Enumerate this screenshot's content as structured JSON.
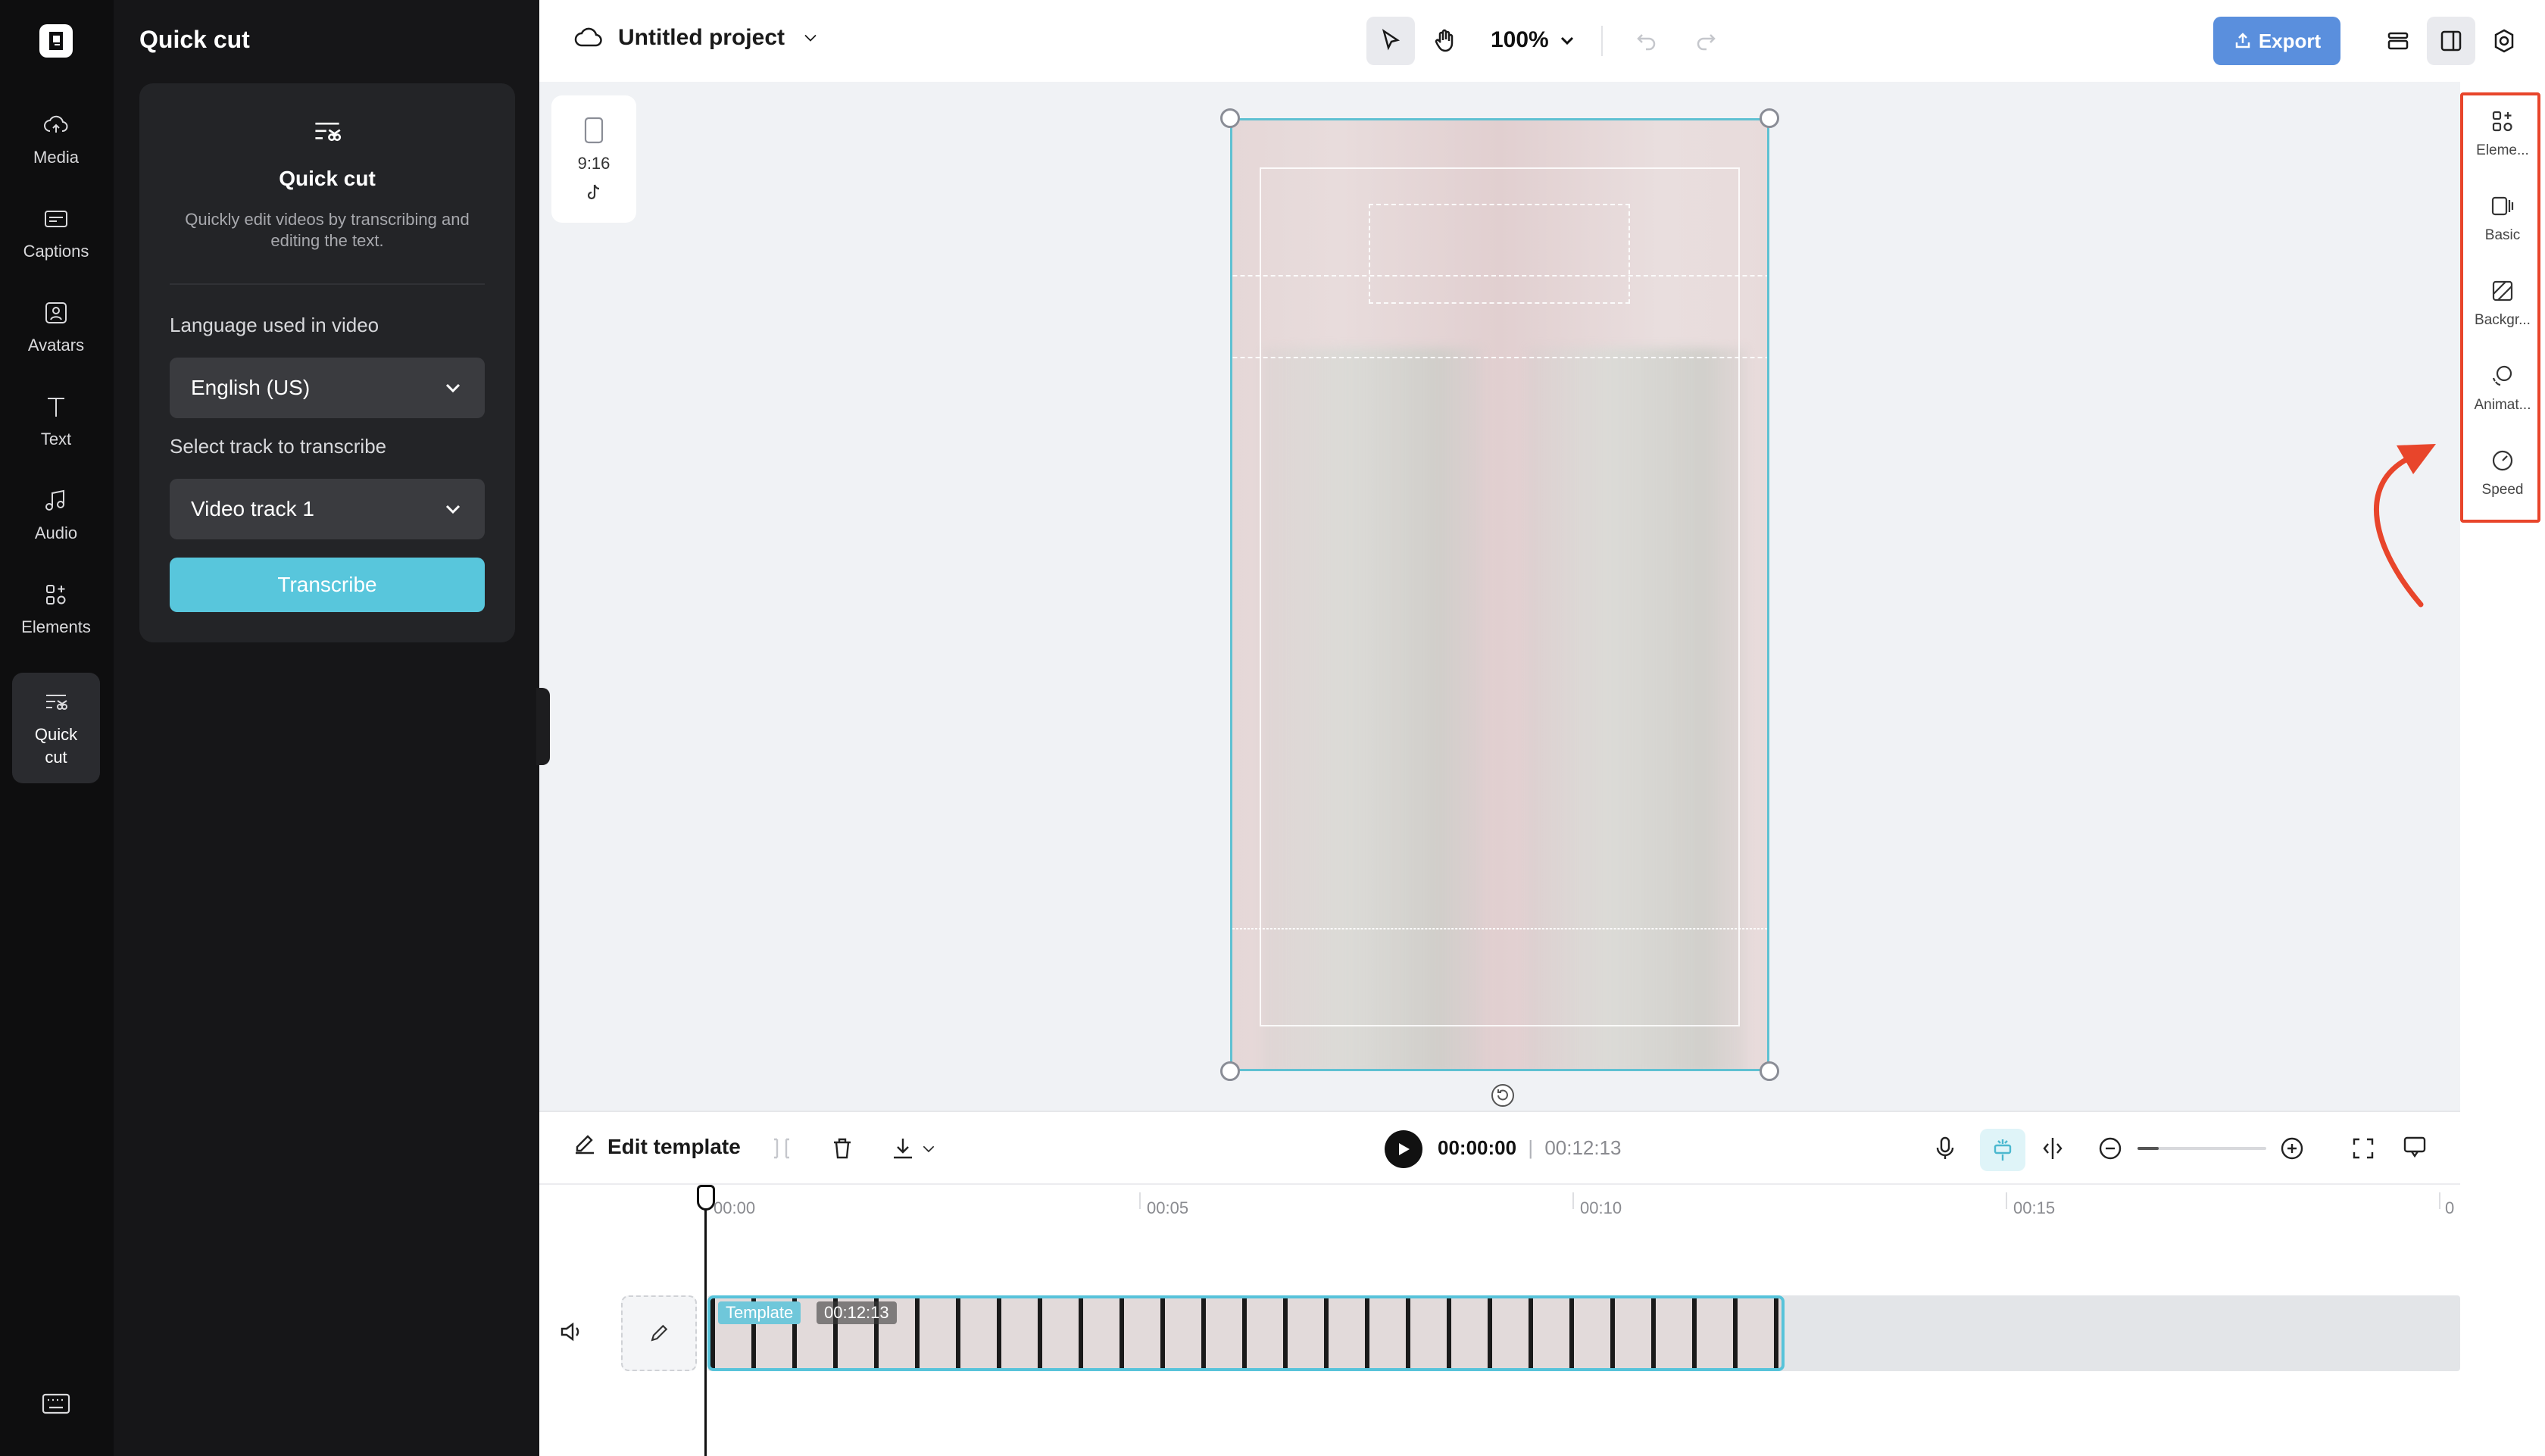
{
  "rail": {
    "items": [
      {
        "label": "Media",
        "icon": "cloud-upload-icon"
      },
      {
        "label": "Captions",
        "icon": "captions-icon"
      },
      {
        "label": "Avatars",
        "icon": "avatar-icon"
      },
      {
        "label": "Text",
        "icon": "text-icon"
      },
      {
        "label": "Audio",
        "icon": "music-note-icon"
      },
      {
        "label": "Elements",
        "icon": "elements-icon"
      },
      {
        "label": "Quick\ncut",
        "icon": "quick-cut-icon"
      }
    ],
    "active": "Quick cut"
  },
  "panel": {
    "title": "Quick cut",
    "card_title": "Quick cut",
    "card_desc": "Quickly edit videos by transcribing and editing the text.",
    "language_label": "Language used in video",
    "language_value": "English (US)",
    "track_label": "Select track to transcribe",
    "track_value": "Video track 1",
    "transcribe_label": "Transcribe"
  },
  "topbar": {
    "project_name": "Untitled project",
    "zoom": "100%",
    "export_label": "Export"
  },
  "ratio": {
    "label": "9:16"
  },
  "rightbar": {
    "items": [
      {
        "label": "Eleme...",
        "icon": "elements-icon"
      },
      {
        "label": "Basic",
        "icon": "basic-icon"
      },
      {
        "label": "Backgr...",
        "icon": "background-icon"
      },
      {
        "label": "Animat...",
        "icon": "animation-icon"
      },
      {
        "label": "Speed",
        "icon": "speed-icon"
      }
    ],
    "highlight_color": "#e8452b"
  },
  "timeline": {
    "edit_template_label": "Edit template",
    "current_time": "00:00:00",
    "total_time": "00:12:13",
    "ruler": [
      "00:00",
      "00:05",
      "00:10",
      "00:15"
    ],
    "clip_tag": "Template",
    "clip_duration": "00:12:13"
  },
  "colors": {
    "accent": "#58c6dc",
    "export": "#5a8fdd",
    "selection": "#5fc1d2"
  }
}
